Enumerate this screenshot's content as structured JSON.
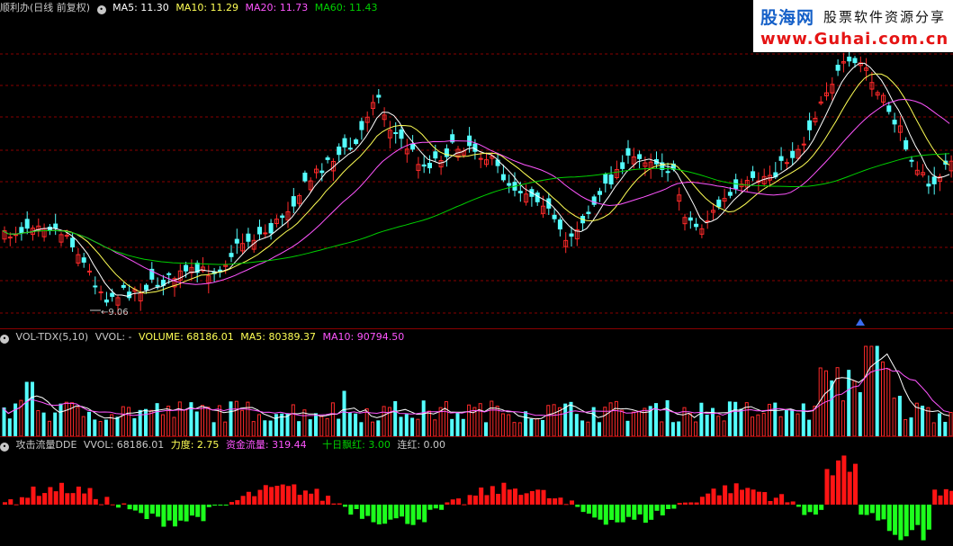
{
  "price_panel": {
    "title": "顺利办(日线 前复权)",
    "ma5": "MA5: 11.30",
    "ma10": "MA10: 11.29",
    "ma20": "MA20: 11.73",
    "ma60": "MA60: 11.43",
    "low_label": "9.06"
  },
  "volume_panel": {
    "title": "VOL-TDX(5,10)",
    "vvol": "VVOL: -",
    "volume": "VOLUME: 68186.01",
    "ma5": "MA5: 80389.37",
    "ma10": "MA10: 90794.50"
  },
  "dde_panel": {
    "title": "攻击流量DDE",
    "vvol": "VVOL: 68186.01",
    "lidu": "力度: 2.75",
    "zijin": "资金流量: 319.44",
    "shiri": "十日飘红: 3.00",
    "lianhong": "连红: 0.00"
  },
  "watermark": {
    "line1": "股海网",
    "line2": "股票软件资源分享",
    "line3": "www.Guhai.com.cn"
  },
  "colors": {
    "up": "#ff2a2a",
    "down": "#54ffff",
    "ma5": "#ffffff",
    "ma10": "#ffff55",
    "ma20": "#ff55ff",
    "ma60": "#00d000",
    "grid": "#8a0000",
    "dde_up": "#ff1414",
    "dde_down": "#1dff1d"
  },
  "icons": [
    "settings-dot-icon",
    "up-arrow-marker-icon"
  ]
}
